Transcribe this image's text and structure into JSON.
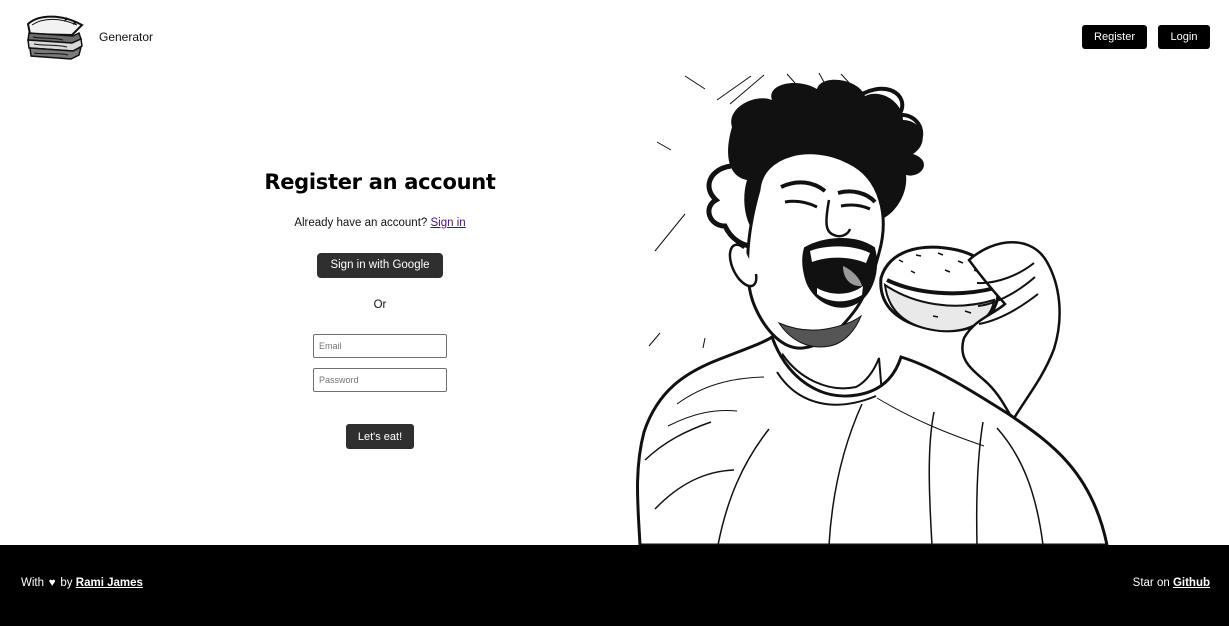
{
  "header": {
    "nav_generator": "Generator",
    "register_label": "Register",
    "login_label": "Login"
  },
  "main": {
    "title": "Register an account",
    "already_prompt": "Already have an account?",
    "sign_in_link": "Sign in",
    "google_button": "Sign in with Google",
    "divider_text": "Or",
    "email_placeholder": "Email",
    "email_value": "",
    "password_placeholder": "Password",
    "password_value": "",
    "submit_label": "Let's eat!"
  },
  "footer": {
    "prefix": "With",
    "heart": "♥",
    "by": "by",
    "author": "Rami James",
    "star_prefix": "Star on",
    "github_link": "Github"
  },
  "colors": {
    "page_background": "#ffffff",
    "primary_button": "#000000",
    "secondary_button": "#2f2f2f",
    "footer_background": "#000000",
    "link": "#4b0f6d"
  },
  "icons": {
    "logo": "sandwich-logo-icon",
    "hero": "laughing-man-eating-sandwich-illustration"
  }
}
